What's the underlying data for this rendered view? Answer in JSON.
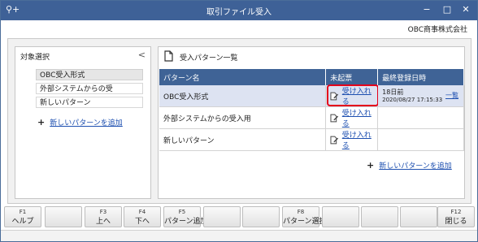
{
  "window": {
    "title": "取引ファイル受入",
    "app_icon": "search-plus-icon",
    "min_glyph": "−",
    "max_glyph": "□",
    "close_glyph": "✕"
  },
  "company": "OBC商事株式会社",
  "left": {
    "title": "対象選択",
    "collapse_glyph": "<",
    "items": [
      {
        "label": "OBC受入形式",
        "selected": true
      },
      {
        "label": "外部システムからの受",
        "selected": false
      },
      {
        "label": "新しいパターン",
        "selected": false
      }
    ],
    "add_label": "新しいパターンを追加"
  },
  "right": {
    "title": "受入パターン一覧",
    "columns": [
      "パターン名",
      "未起票",
      "最終登録日時"
    ],
    "rows": [
      {
        "name": "OBC受入形式",
        "action": "受け入れる",
        "ago": "18日前",
        "stamp": "2020/08/27 17:15:33",
        "view": "一覧"
      },
      {
        "name": "外部システムからの受入用",
        "action": "受け入れる",
        "ago": "",
        "stamp": "",
        "view": ""
      },
      {
        "name": "新しいパターン",
        "action": "受け入れる",
        "ago": "",
        "stamp": "",
        "view": ""
      }
    ],
    "add_label": "新しいパターンを追加"
  },
  "fkeys": [
    {
      "num": "F1",
      "label": "ヘルプ"
    },
    {
      "num": "",
      "label": ""
    },
    {
      "num": "F3",
      "label": "上へ"
    },
    {
      "num": "F4",
      "label": "下へ"
    },
    {
      "num": "F5",
      "label": "パターン追加"
    },
    {
      "num": "",
      "label": ""
    },
    {
      "num": "",
      "label": ""
    },
    {
      "num": "F8",
      "label": "パターン選択"
    },
    {
      "num": "",
      "label": ""
    },
    {
      "num": "",
      "label": ""
    },
    {
      "num": "",
      "label": ""
    },
    {
      "num": "F12",
      "label": "閉じる"
    }
  ],
  "colors": {
    "title_bar": "#3e6197",
    "grid_header": "#3f6396",
    "highlight": "#e4001b",
    "link": "#1d4fb0"
  }
}
